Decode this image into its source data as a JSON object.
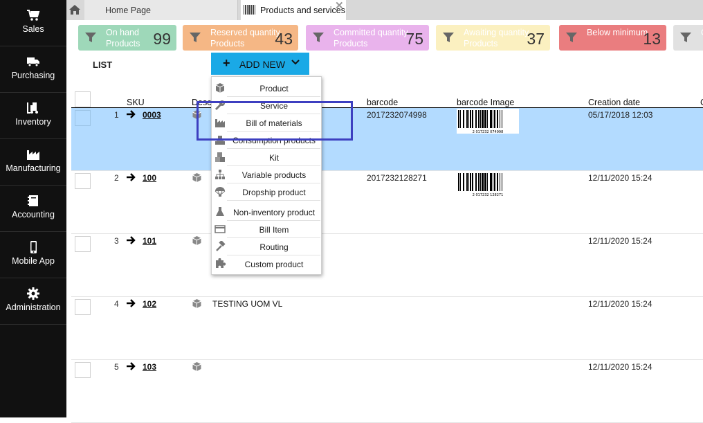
{
  "sidebar": {
    "items": [
      {
        "label": "Sales",
        "icon": "cart-icon"
      },
      {
        "label": "Purchasing",
        "icon": "truck-icon"
      },
      {
        "label": "Inventory",
        "icon": "forklift-icon"
      },
      {
        "label": "Manufacturing",
        "icon": "factory-icon"
      },
      {
        "label": "Accounting",
        "icon": "ledger-icon"
      },
      {
        "label": "Mobile App",
        "icon": "phone-icon"
      },
      {
        "label": "Administration",
        "icon": "gear-icon"
      }
    ]
  },
  "tabs": {
    "home": "Home Page",
    "active": "Products and services",
    "close": "✕"
  },
  "filters": [
    {
      "line1": "On hand",
      "line2": "Products",
      "count": "99",
      "color": "#9ed8b9"
    },
    {
      "line1": "Reserved quantity",
      "line2": "Products",
      "count": "43",
      "color": "#f5b785"
    },
    {
      "line1": "Committed quantity",
      "line2": "Products",
      "count": "75",
      "color": "#e9b3ec"
    },
    {
      "line1": "Awaiting quantity",
      "line2": "Products",
      "count": "37",
      "color": "#fbf0c0"
    },
    {
      "line1": "Below minimum",
      "line2": "",
      "count": "13",
      "color": "#ea7d7f"
    },
    {
      "line1": "C",
      "line2": "",
      "count": "",
      "color": "#e1e1e1"
    }
  ],
  "list_title": "LIST",
  "add_new": {
    "label": "ADD NEW",
    "color": "#1aa9e6"
  },
  "columns": {
    "sku": "SKU",
    "description": "Desc",
    "barcode": "barcode",
    "barcode_image": "barcode Image",
    "creation_date": "Creation date",
    "extra": "C"
  },
  "rows": [
    {
      "num": "1",
      "sku": "0003",
      "description": "",
      "barcode": "2017232074998",
      "has_barcode_image": true,
      "barcode_digits": "2 017232 074998",
      "date": "05/17/2018 12:03",
      "selected": true
    },
    {
      "num": "2",
      "sku": "100",
      "description": "",
      "barcode": "2017232128271",
      "has_barcode_image": true,
      "barcode_digits": "2 017232 128271",
      "date": "12/11/2020 15:24",
      "selected": false
    },
    {
      "num": "3",
      "sku": "101",
      "description": "",
      "barcode": "",
      "has_barcode_image": false,
      "date": "12/11/2020 15:24",
      "selected": false
    },
    {
      "num": "4",
      "sku": "102",
      "description": "TESTING UOM VL",
      "barcode": "",
      "has_barcode_image": false,
      "date": "12/11/2020 15:24",
      "selected": false
    },
    {
      "num": "5",
      "sku": "103",
      "description": "",
      "barcode": "",
      "has_barcode_image": false,
      "date": "12/11/2020 15:24",
      "selected": false
    }
  ],
  "menu": {
    "items": [
      {
        "label": "Product",
        "icon": "cube-icon"
      },
      {
        "label": "Service",
        "icon": "wrench-icon"
      },
      {
        "label": "Bill of materials",
        "icon": "factory-icon"
      },
      {
        "label": "Consumption products",
        "icon": "stack-icon"
      },
      {
        "label": "Kit",
        "icon": "boxes-icon"
      },
      {
        "label": "Variable products",
        "icon": "hierarchy-icon"
      },
      {
        "label": "Dropship product",
        "icon": "parachute-icon"
      },
      {
        "label": "Non-inventory product",
        "icon": "flask-icon"
      },
      {
        "label": "Bill Item",
        "icon": "card-icon"
      },
      {
        "label": "Routing",
        "icon": "hammer-icon"
      },
      {
        "label": "Custom product",
        "icon": "puzzle-icon"
      }
    ]
  },
  "highlight_color": "#3d3fc0"
}
